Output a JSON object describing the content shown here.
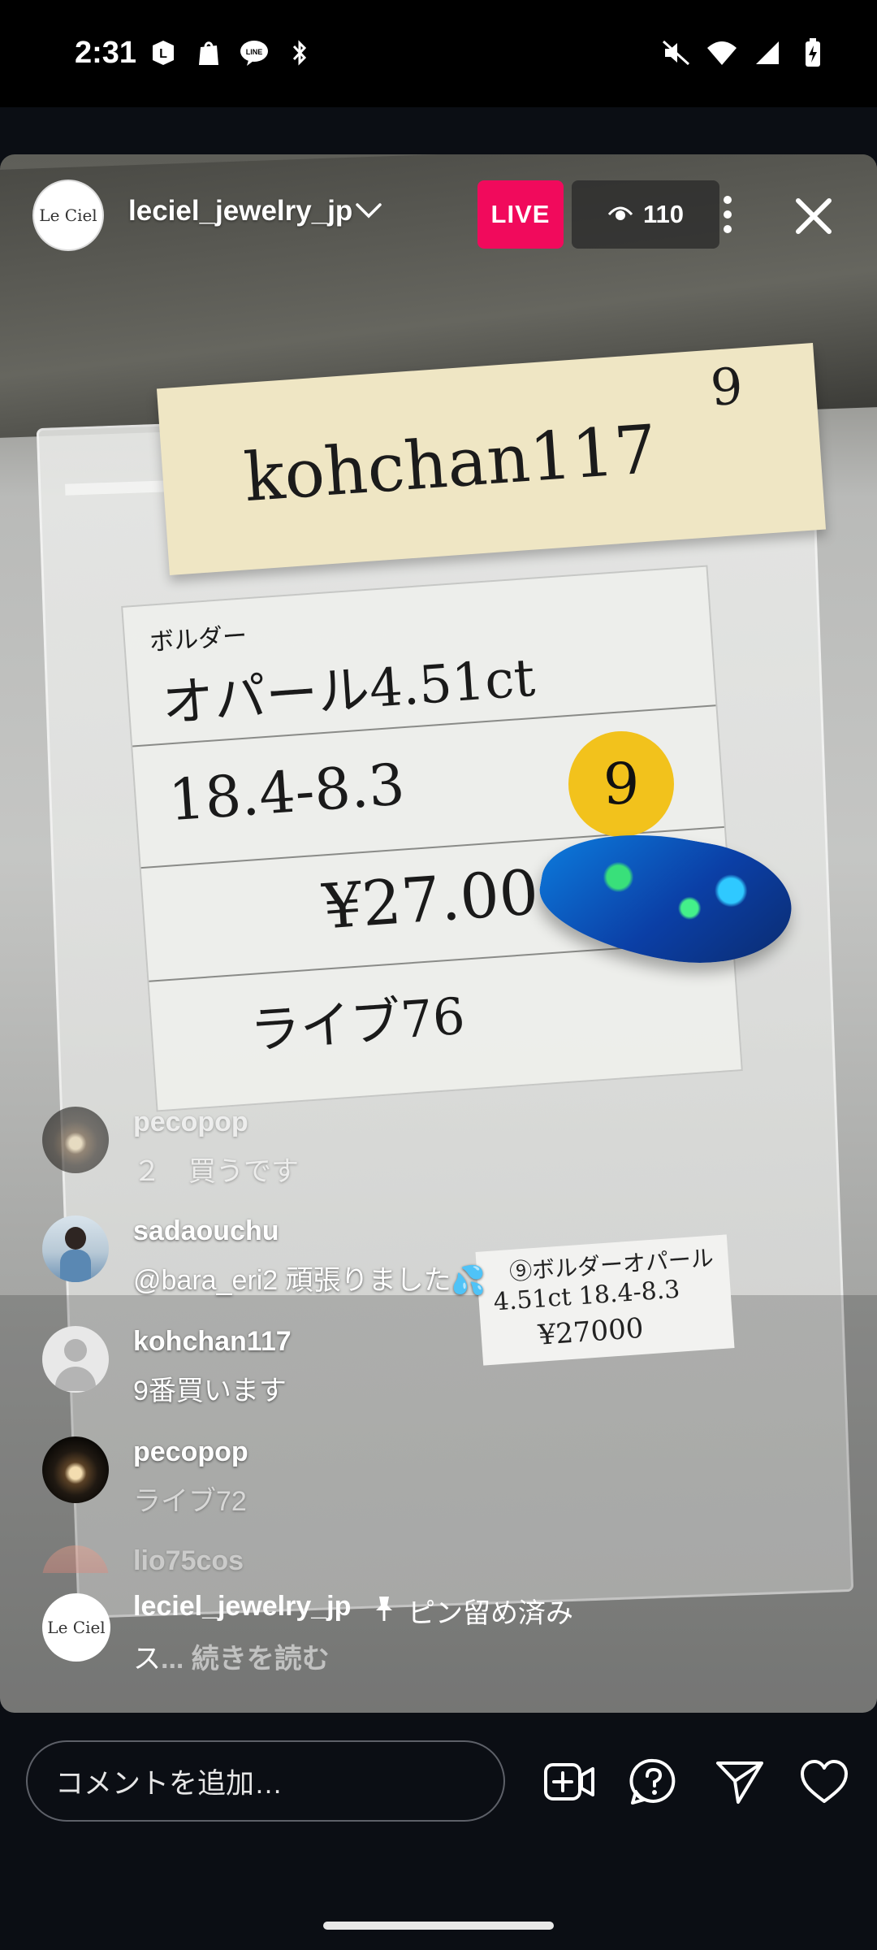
{
  "status_bar": {
    "time": "2:31",
    "left_icons": [
      "L-app-icon",
      "shopify-icon",
      "line-icon",
      "bluetooth-icon"
    ],
    "right_icons": [
      "mute-icon",
      "wifi-icon",
      "signal-icon",
      "battery-icon"
    ]
  },
  "live": {
    "host_username": "leciel_jewelry_jp",
    "host_logo_text": "Le Ciel",
    "live_label": "LIVE",
    "viewer_count": "110"
  },
  "video": {
    "note_name": "kohchan117",
    "note_number": "9",
    "card_line1": "ボルダー",
    "card_line2": "オパール4.51ct",
    "card_line3": "18.4-8.3",
    "card_line4": "¥27.000",
    "card_line5": "ライブ76",
    "badge_number": "9",
    "small_label_line1": "⑨ボルダーオパール",
    "small_label_line2": "4.51ct 18.4-8.3",
    "small_label_line3": "¥27000"
  },
  "comments": [
    {
      "user": "pecopop",
      "text": "２　買うです"
    },
    {
      "user": "sadaouchu",
      "text": "@bara_eri2 頑張りました💦"
    },
    {
      "user": "kohchan117",
      "text": "9番買います"
    },
    {
      "user": "pecopop",
      "text": "ライブ72"
    },
    {
      "user": "lio75cos",
      "text": ""
    }
  ],
  "pinned": {
    "user": "leciel_jewelry_jp",
    "label": "ピン留め済み",
    "text": "ス",
    "read_more": "... 続きを読む"
  },
  "bottom_bar": {
    "comment_placeholder": "コメントを追加…",
    "icons": [
      "add-video-guest-icon",
      "question-icon",
      "send-icon",
      "heart-icon"
    ]
  }
}
